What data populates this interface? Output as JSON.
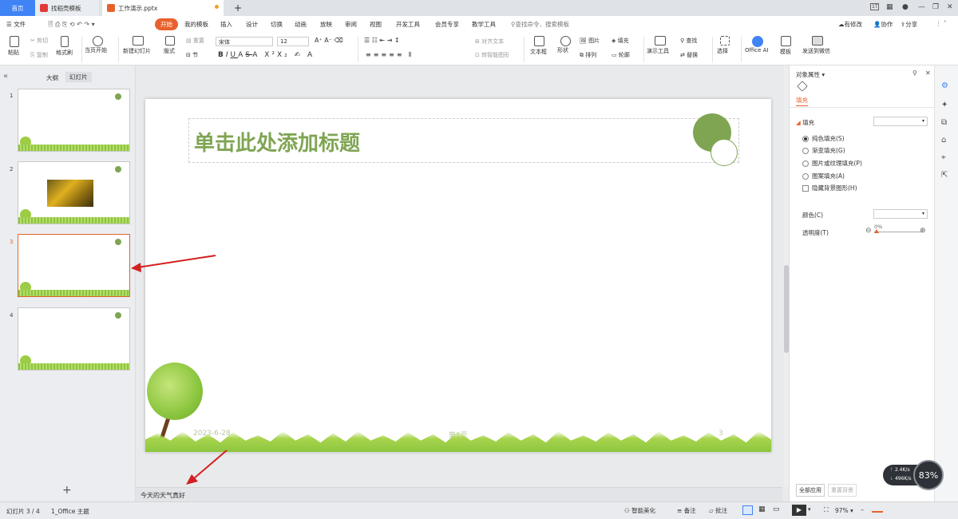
{
  "tabs": {
    "home": "首页",
    "template": "找稻壳模板",
    "doc": "工作演示.pptx",
    "add": "+"
  },
  "window": {
    "badge": "1T",
    "min": "—",
    "max": "❐",
    "close": "✕"
  },
  "menu": {
    "file": "☰ 文件",
    "items": [
      "开始",
      "我的模板",
      "插入",
      "设计",
      "切换",
      "动画",
      "放映",
      "审阅",
      "视图",
      "开发工具",
      "会员专享",
      "教学工具"
    ],
    "search": "查找命令、搜索模板",
    "right": [
      "有修改",
      "协作",
      "分享"
    ]
  },
  "ribbon": {
    "paste": "粘贴",
    "cut": "剪切",
    "copy": "复制",
    "format_painter": "格式刷",
    "from_current": "当页开始",
    "new_slide": "新建幻灯片",
    "layout": "版式",
    "section": "节",
    "reset": "重置",
    "font": "宋体",
    "size": "12",
    "align_text": "对齐文本",
    "smartart": "转智能图形",
    "textbox": "文本框",
    "shape": "形状",
    "picture": "图片",
    "fill": "填充",
    "arrange": "排列",
    "outline": "轮廓",
    "present_tools": "演示工具",
    "find": "查找",
    "replace": "替换",
    "select": "选择",
    "office_ai": "Office AI",
    "template": "模板",
    "send_wechat": "发送到微信"
  },
  "left_panel": {
    "outline_tab": "大纲",
    "slides_tab": "幻灯片",
    "add": "+",
    "collapse": "«"
  },
  "thumbnails": [
    {
      "num": "1",
      "selected": false,
      "has_photo": false
    },
    {
      "num": "2",
      "selected": false,
      "has_photo": true
    },
    {
      "num": "3",
      "selected": true,
      "has_photo": false
    },
    {
      "num": "4",
      "selected": false,
      "has_photo": false
    }
  ],
  "slide": {
    "title": "单击此处添加标题",
    "date": "2023-6-28",
    "page": "第1页",
    "number": "3",
    "accent": "#7fa553"
  },
  "notes": "今天的天气真好",
  "right_panel": {
    "title": "对象属性",
    "tab": "填充",
    "fill_section": "填充",
    "options": [
      {
        "label": "纯色填充(S)",
        "checked": true
      },
      {
        "label": "渐变填充(G)",
        "checked": false
      },
      {
        "label": "图片或纹理填充(P)",
        "checked": false
      },
      {
        "label": "图案填充(A)",
        "checked": false
      }
    ],
    "hide_bg": "隐藏背景图形(H)",
    "color_label": "颜色(C)",
    "transparency_label": "透明度(T)",
    "transparency_value": "0%",
    "apply_all": "全部应用",
    "reset_bg": "重置背景"
  },
  "network": {
    "up": "2.4K/s",
    "down": "496K/s",
    "percent": "83%"
  },
  "status": {
    "slide_info": "幻灯片 3 / 4",
    "theme": "1_Office 主题",
    "smart": "智能美化",
    "notes": "备注",
    "comments": "批注",
    "zoom": "97%"
  },
  "colors": {
    "accent_orange": "#e8612c",
    "tab_blue": "#3f83f5",
    "green": "#7fa553"
  }
}
